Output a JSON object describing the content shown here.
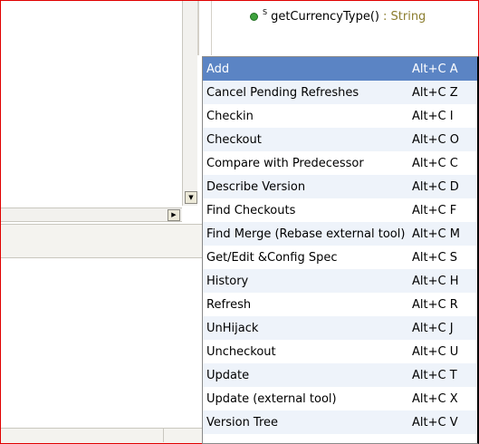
{
  "outline": {
    "static_marker": "S",
    "method_name": "getCurrencyType()",
    "return_type": " : String"
  },
  "scrollbars": {
    "down_arrow": "▼",
    "right_arrow": "▶"
  },
  "context_menu": {
    "selected_index": 0,
    "items": [
      {
        "label": "Add",
        "accel": "Alt+C A"
      },
      {
        "label": "Cancel Pending Refreshes",
        "accel": "Alt+C Z"
      },
      {
        "label": "Checkin",
        "accel": "Alt+C I"
      },
      {
        "label": "Checkout",
        "accel": "Alt+C O"
      },
      {
        "label": "Compare with Predecessor",
        "accel": "Alt+C C"
      },
      {
        "label": "Describe Version",
        "accel": "Alt+C D"
      },
      {
        "label": "Find Checkouts",
        "accel": "Alt+C F"
      },
      {
        "label": "Find Merge (Rebase external tool)",
        "accel": "Alt+C M"
      },
      {
        "label": "Get/Edit &Config Spec",
        "accel": "Alt+C S"
      },
      {
        "label": "History",
        "accel": "Alt+C H"
      },
      {
        "label": "Refresh",
        "accel": "Alt+C R"
      },
      {
        "label": "UnHijack",
        "accel": "Alt+C J"
      },
      {
        "label": "Uncheckout",
        "accel": "Alt+C U"
      },
      {
        "label": "Update",
        "accel": "Alt+C T"
      },
      {
        "label": "Update (external tool)",
        "accel": "Alt+C X"
      },
      {
        "label": "Version Tree",
        "accel": "Alt+C V"
      }
    ]
  },
  "colors": {
    "selection": "#5b84c4",
    "alternate_row": "#eef3fa",
    "frame_border": "#e00000",
    "method_icon": "#3ea23e",
    "return_type": "#8b7d2e"
  }
}
